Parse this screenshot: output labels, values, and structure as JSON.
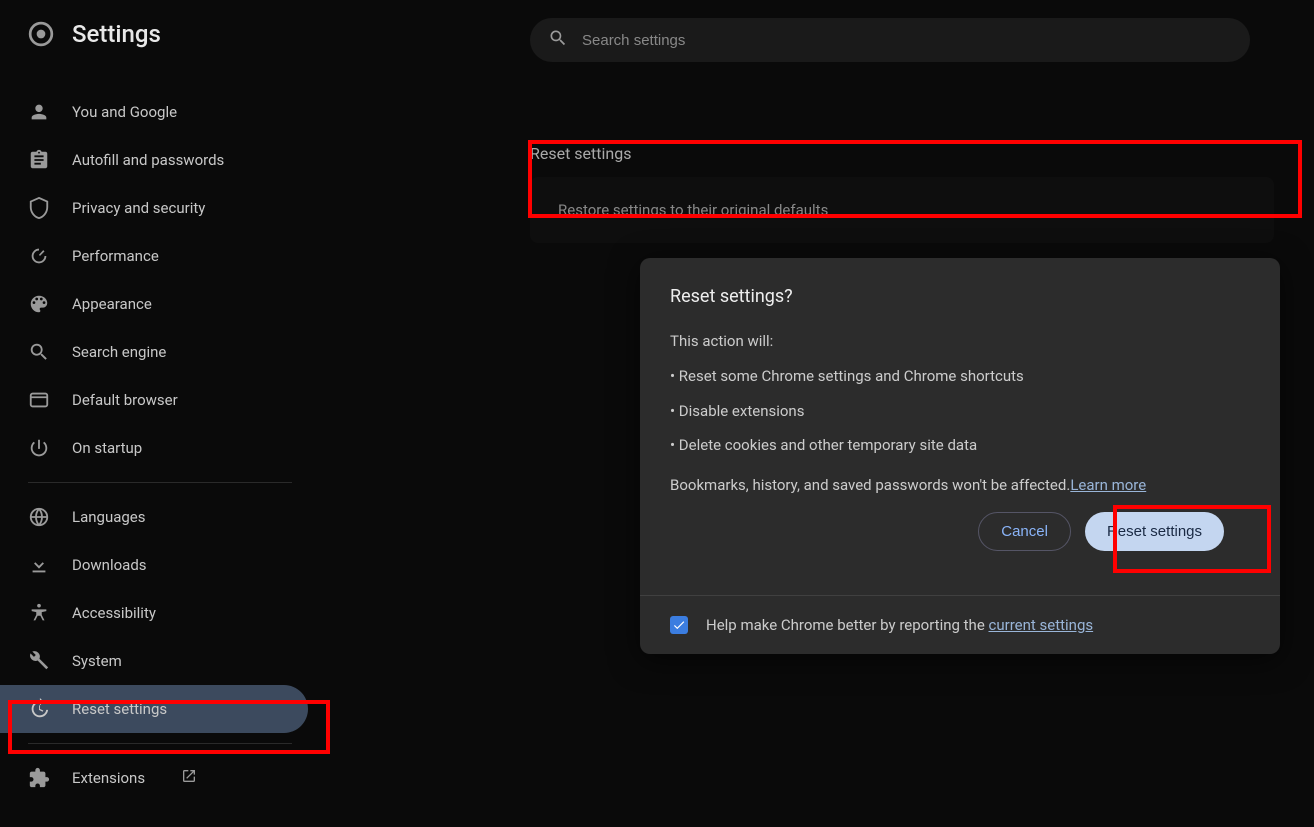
{
  "header": {
    "title": "Settings"
  },
  "search": {
    "placeholder": "Search settings"
  },
  "sidebar": {
    "group1": [
      {
        "label": "You and Google",
        "icon": "person"
      },
      {
        "label": "Autofill and passwords",
        "icon": "clipboard"
      },
      {
        "label": "Privacy and security",
        "icon": "shield"
      },
      {
        "label": "Performance",
        "icon": "speedometer"
      },
      {
        "label": "Appearance",
        "icon": "palette"
      },
      {
        "label": "Search engine",
        "icon": "search"
      },
      {
        "label": "Default browser",
        "icon": "browser"
      },
      {
        "label": "On startup",
        "icon": "power"
      }
    ],
    "group2": [
      {
        "label": "Languages",
        "icon": "globe"
      },
      {
        "label": "Downloads",
        "icon": "download"
      },
      {
        "label": "Accessibility",
        "icon": "accessibility"
      },
      {
        "label": "System",
        "icon": "wrench"
      },
      {
        "label": "Reset settings",
        "icon": "history",
        "active": true
      }
    ],
    "group3": [
      {
        "label": "Extensions",
        "icon": "extension",
        "external": true
      }
    ]
  },
  "main": {
    "section_title": "Reset settings",
    "row_label": "Restore settings to their original defaults"
  },
  "dialog": {
    "title": "Reset settings?",
    "lead": "This action will:",
    "bullets": [
      "Reset some Chrome settings and Chrome shortcuts",
      "Disable extensions",
      "Delete cookies and other temporary site data"
    ],
    "footer_prefix": "Bookmarks, history, and saved passwords won't be affected.",
    "learn_more": "Learn more",
    "cancel": "Cancel",
    "confirm": "Reset settings",
    "checkbox_text_prefix": "Help make Chrome better by reporting the ",
    "checkbox_link": "current settings",
    "checkbox_checked": true
  }
}
